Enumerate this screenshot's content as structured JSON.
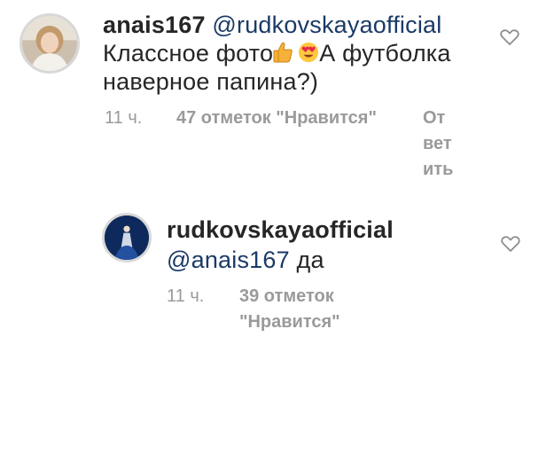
{
  "comments": [
    {
      "username": "anais167",
      "mention": "@rudkovskaya­official",
      "text_before_emoji": "Классное фото",
      "emoji_1": "thumbs-up",
      "emoji_2": "heart-eyes",
      "text_after_emoji": "А футболка",
      "text_line_2": "наверное папина?)",
      "time": "11 ч.",
      "likes": "47 отметок \"Нравится\"",
      "reply_parts": [
        "От",
        "вет",
        "ить"
      ]
    },
    {
      "username": "rudkovskayaofficial",
      "mention": "@anais167",
      "text": "да",
      "time": "11 ч.",
      "likes_line_1": "39 отметок",
      "likes_line_2": "\"Нравится\""
    }
  ],
  "icons": {
    "like": "heart-outline-icon"
  },
  "colors": {
    "text": "#262626",
    "mention": "#1b3a66",
    "meta": "#9a9a9a"
  }
}
